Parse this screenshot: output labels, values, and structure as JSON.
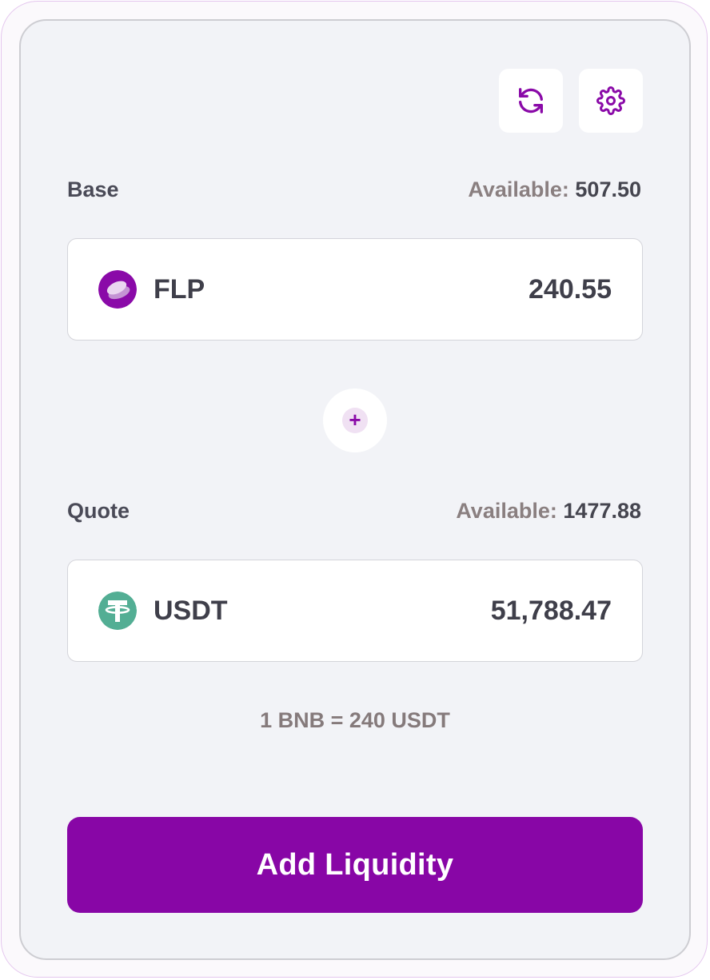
{
  "toolbar": {
    "refresh_icon": "refresh-icon",
    "settings_icon": "gear-icon"
  },
  "base": {
    "label": "Base",
    "available_label": "Available:",
    "available_value": "507.50",
    "token_symbol": "FLP",
    "token_icon": "flp-token-icon",
    "amount": "240.55"
  },
  "plus": {
    "glyph": "+"
  },
  "quote": {
    "label": "Quote",
    "available_label": "Available:",
    "available_value": "1477.88",
    "token_symbol": "USDT",
    "token_icon": "usdt-token-icon",
    "amount": "51,788.47"
  },
  "rate_text": "1 BNB = 240 USDT",
  "submit_label": "Add Liquidity",
  "colors": {
    "accent": "#8806a6",
    "usdt": "#53ae94",
    "background": "#f2f3f7"
  }
}
